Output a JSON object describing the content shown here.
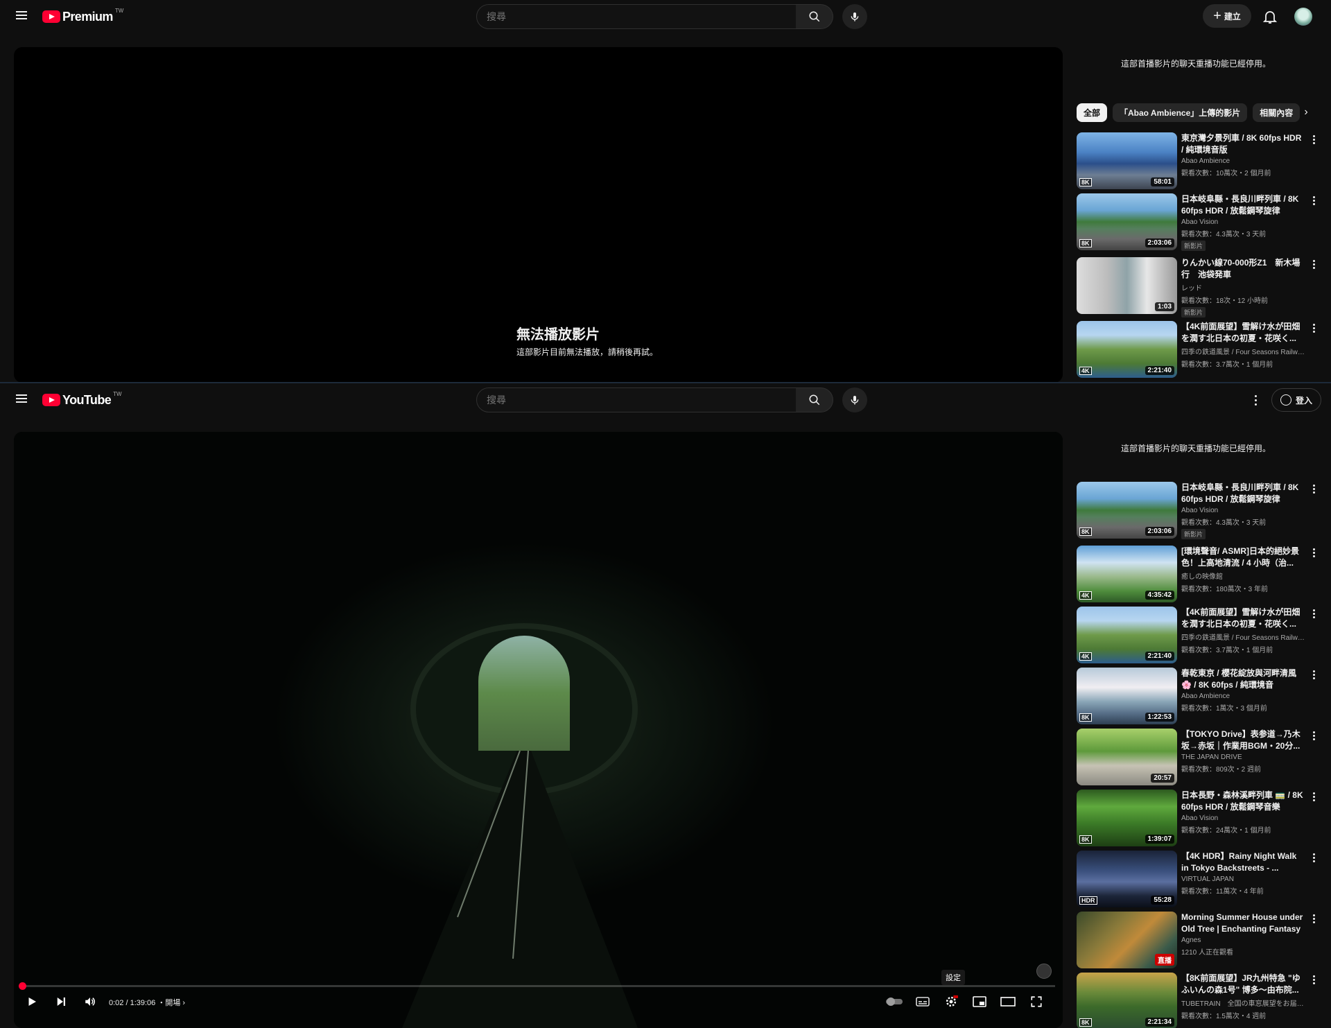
{
  "top": {
    "logo_word": "Premium",
    "region": "TW",
    "search_placeholder": "搜尋",
    "create_label": "建立",
    "player": {
      "error_title": "無法播放影片",
      "error_subtitle": "這部影片目前無法播放，請稍後再試。"
    },
    "chat_notice": "這部首播影片的聊天重播功能已經停用。",
    "chips": [
      "全部",
      "「Abao Ambience」上傳的影片",
      "相關內容"
    ],
    "videos": [
      {
        "title": "東京灣夕景列車 / 8K 60fps HDR / 純環境音版",
        "channel": "Abao Ambience",
        "stats": "觀看次數：10萬次・2 個月前",
        "duration": "58:01",
        "quality": "8K",
        "badge": "",
        "thumb": "t-blue-bridge"
      },
      {
        "title": "日本岐阜縣・長良川畔列車 / 8K 60fps HDR / 放鬆鋼琴旋律",
        "channel": "Abao Vision",
        "stats": "觀看次數：4.3萬次・3 天前",
        "duration": "2:03:06",
        "quality": "8K",
        "badge": "新影片",
        "thumb": "t-river"
      },
      {
        "title": "りんかい線70-000形Z1　新木場行　池袋発車",
        "channel": "レッド",
        "stats": "觀看次數：18次・12 小時前",
        "duration": "1:03",
        "quality": "",
        "badge": "新影片",
        "thumb": "t-train"
      },
      {
        "title": "【4K前面展望】雪解け水が田畑を潤す北日本の初夏・花咲く...",
        "channel": "四季の鉄道風景 / Four Seasons Railways...",
        "stats": "觀看次數：3.7萬次・1 個月前",
        "duration": "2:21:40",
        "quality": "4K",
        "badge": "",
        "thumb": "t-field"
      }
    ]
  },
  "bottom": {
    "logo_word": "YouTube",
    "region": "TW",
    "search_placeholder": "搜尋",
    "signin_label": "登入",
    "player": {
      "time": "0:02 / 1:39:06",
      "chapter": "・開場",
      "tooltip": "設定",
      "progress_fraction": 0.0003
    },
    "chat_notice": "這部首播影片的聊天重播功能已經停用。",
    "videos": [
      {
        "title": "日本岐阜縣・長良川畔列車 / 8K 60fps HDR / 放鬆鋼琴旋律",
        "channel": "Abao Vision",
        "stats": "觀看次數：4.3萬次・3 天前",
        "duration": "2:03:06",
        "quality": "8K",
        "badge": "新影片",
        "thumb": "t-river"
      },
      {
        "title": "[環境聲音/ ASMR]日本的絕妙景色！上高地清流 / 4 小時（治...",
        "channel": "癒しの映像館",
        "stats": "觀看次數：180萬次・3 年前",
        "duration": "4:35:42",
        "quality": "4K",
        "badge": "",
        "thumb": "t-mountain"
      },
      {
        "title": "【4K前面展望】雪解け水が田畑を潤す北日本の初夏・花咲く...",
        "channel": "四季の鉄道風景 / Four Seasons Railways...",
        "stats": "觀看次數：3.7萬次・1 個月前",
        "duration": "2:21:40",
        "quality": "4K",
        "badge": "",
        "thumb": "t-field"
      },
      {
        "title": "春乾東京 / 櫻花綻放與河畔清風 🌸 / 8K 60fps / 純環境音",
        "channel": "Abao Ambience",
        "stats": "觀看次數：1萬次・3 個月前",
        "duration": "1:22:53",
        "quality": "8K",
        "badge": "",
        "thumb": "t-sakura"
      },
      {
        "title": "【TOKYO Drive】表参道→乃木坂→赤坂｜作業用BGM・20分...",
        "channel": "THE JAPAN DRIVE",
        "stats": "觀看次數：809次・2 週前",
        "duration": "20:57",
        "quality": "",
        "badge": "",
        "thumb": "t-street"
      },
      {
        "title": "日本長野・森林溪畔列車 🚃 / 8K 60fps HDR / 放鬆鋼琴音樂",
        "channel": "Abao Vision",
        "stats": "觀看次數：24萬次・1 個月前",
        "duration": "1:39:07",
        "quality": "8K",
        "badge": "",
        "thumb": "t-forest"
      },
      {
        "title": "【4K HDR】Rainy Night Walk in Tokyo Backstreets - ...",
        "channel": "VIRTUAL JAPAN",
        "stats": "觀看次數：11萬次・4 年前",
        "duration": "55:28",
        "quality": "HDR",
        "badge": "",
        "thumb": "t-night"
      },
      {
        "title": "Morning Summer House under Old Tree | Enchanting Fantasy ...",
        "channel": "Agnes",
        "stats": "1210 人正在觀看",
        "duration": "",
        "quality": "",
        "badge": "直播",
        "thumb": "t-fantasy"
      },
      {
        "title": "【8K前面展望】JR九州特急 \"ゆふいんの森1号\" 博多〜由布院...",
        "channel": "TUBETRAIN　全国の車窓展望をお届け...",
        "stats": "觀看次數：1.5萬次・4 週前",
        "duration": "2:21:34",
        "quality": "8K",
        "badge": "",
        "thumb": "t-yufuin"
      }
    ]
  },
  "colors": {
    "background": "#0f0f0f",
    "accent_red": "#ff0033",
    "text_primary": "#f1f1f1",
    "text_secondary": "#aaaaaa"
  }
}
